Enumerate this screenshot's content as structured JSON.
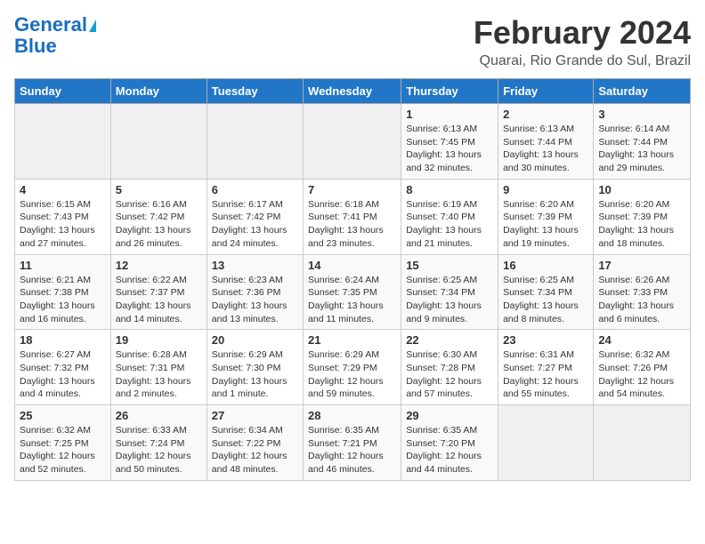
{
  "logo": {
    "line1": "General",
    "line2": "Blue"
  },
  "title": "February 2024",
  "subtitle": "Quarai, Rio Grande do Sul, Brazil",
  "days_header": [
    "Sunday",
    "Monday",
    "Tuesday",
    "Wednesday",
    "Thursday",
    "Friday",
    "Saturday"
  ],
  "weeks": [
    [
      {
        "day": "",
        "info": ""
      },
      {
        "day": "",
        "info": ""
      },
      {
        "day": "",
        "info": ""
      },
      {
        "day": "",
        "info": ""
      },
      {
        "day": "1",
        "info": "Sunrise: 6:13 AM\nSunset: 7:45 PM\nDaylight: 13 hours and 32 minutes."
      },
      {
        "day": "2",
        "info": "Sunrise: 6:13 AM\nSunset: 7:44 PM\nDaylight: 13 hours and 30 minutes."
      },
      {
        "day": "3",
        "info": "Sunrise: 6:14 AM\nSunset: 7:44 PM\nDaylight: 13 hours and 29 minutes."
      }
    ],
    [
      {
        "day": "4",
        "info": "Sunrise: 6:15 AM\nSunset: 7:43 PM\nDaylight: 13 hours and 27 minutes."
      },
      {
        "day": "5",
        "info": "Sunrise: 6:16 AM\nSunset: 7:42 PM\nDaylight: 13 hours and 26 minutes."
      },
      {
        "day": "6",
        "info": "Sunrise: 6:17 AM\nSunset: 7:42 PM\nDaylight: 13 hours and 24 minutes."
      },
      {
        "day": "7",
        "info": "Sunrise: 6:18 AM\nSunset: 7:41 PM\nDaylight: 13 hours and 23 minutes."
      },
      {
        "day": "8",
        "info": "Sunrise: 6:19 AM\nSunset: 7:40 PM\nDaylight: 13 hours and 21 minutes."
      },
      {
        "day": "9",
        "info": "Sunrise: 6:20 AM\nSunset: 7:39 PM\nDaylight: 13 hours and 19 minutes."
      },
      {
        "day": "10",
        "info": "Sunrise: 6:20 AM\nSunset: 7:39 PM\nDaylight: 13 hours and 18 minutes."
      }
    ],
    [
      {
        "day": "11",
        "info": "Sunrise: 6:21 AM\nSunset: 7:38 PM\nDaylight: 13 hours and 16 minutes."
      },
      {
        "day": "12",
        "info": "Sunrise: 6:22 AM\nSunset: 7:37 PM\nDaylight: 13 hours and 14 minutes."
      },
      {
        "day": "13",
        "info": "Sunrise: 6:23 AM\nSunset: 7:36 PM\nDaylight: 13 hours and 13 minutes."
      },
      {
        "day": "14",
        "info": "Sunrise: 6:24 AM\nSunset: 7:35 PM\nDaylight: 13 hours and 11 minutes."
      },
      {
        "day": "15",
        "info": "Sunrise: 6:25 AM\nSunset: 7:34 PM\nDaylight: 13 hours and 9 minutes."
      },
      {
        "day": "16",
        "info": "Sunrise: 6:25 AM\nSunset: 7:34 PM\nDaylight: 13 hours and 8 minutes."
      },
      {
        "day": "17",
        "info": "Sunrise: 6:26 AM\nSunset: 7:33 PM\nDaylight: 13 hours and 6 minutes."
      }
    ],
    [
      {
        "day": "18",
        "info": "Sunrise: 6:27 AM\nSunset: 7:32 PM\nDaylight: 13 hours and 4 minutes."
      },
      {
        "day": "19",
        "info": "Sunrise: 6:28 AM\nSunset: 7:31 PM\nDaylight: 13 hours and 2 minutes."
      },
      {
        "day": "20",
        "info": "Sunrise: 6:29 AM\nSunset: 7:30 PM\nDaylight: 13 hours and 1 minute."
      },
      {
        "day": "21",
        "info": "Sunrise: 6:29 AM\nSunset: 7:29 PM\nDaylight: 12 hours and 59 minutes."
      },
      {
        "day": "22",
        "info": "Sunrise: 6:30 AM\nSunset: 7:28 PM\nDaylight: 12 hours and 57 minutes."
      },
      {
        "day": "23",
        "info": "Sunrise: 6:31 AM\nSunset: 7:27 PM\nDaylight: 12 hours and 55 minutes."
      },
      {
        "day": "24",
        "info": "Sunrise: 6:32 AM\nSunset: 7:26 PM\nDaylight: 12 hours and 54 minutes."
      }
    ],
    [
      {
        "day": "25",
        "info": "Sunrise: 6:32 AM\nSunset: 7:25 PM\nDaylight: 12 hours and 52 minutes."
      },
      {
        "day": "26",
        "info": "Sunrise: 6:33 AM\nSunset: 7:24 PM\nDaylight: 12 hours and 50 minutes."
      },
      {
        "day": "27",
        "info": "Sunrise: 6:34 AM\nSunset: 7:22 PM\nDaylight: 12 hours and 48 minutes."
      },
      {
        "day": "28",
        "info": "Sunrise: 6:35 AM\nSunset: 7:21 PM\nDaylight: 12 hours and 46 minutes."
      },
      {
        "day": "29",
        "info": "Sunrise: 6:35 AM\nSunset: 7:20 PM\nDaylight: 12 hours and 44 minutes."
      },
      {
        "day": "",
        "info": ""
      },
      {
        "day": "",
        "info": ""
      }
    ]
  ]
}
